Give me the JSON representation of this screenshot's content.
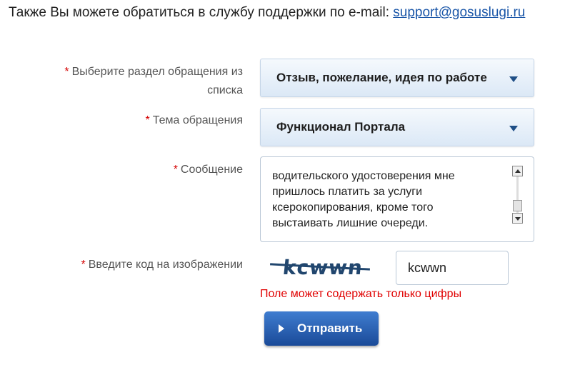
{
  "intro": {
    "text": "Также Вы можете обратиться в службу поддержки по e-mail: ",
    "email": "support@gosuslugi.ru"
  },
  "form": {
    "required_marker": "*",
    "section": {
      "label_line1": "Выберите раздел обращения из",
      "label_line2": "списка",
      "value": "Отзыв, пожелание, идея по работе"
    },
    "topic": {
      "label": "Тема обращения",
      "value": "Функционал Портала"
    },
    "message": {
      "label": "Сообщение",
      "value": "водительского удостоверения мне\nпришлось платить за услуги\nксерокопирования, кроме того\nвыстаивать лишние очереди."
    },
    "captcha": {
      "label": "Введите код на изображении",
      "image_text": "kcwwn",
      "input_value": "kcwwn",
      "error": "Поле может содержать только цифры"
    },
    "submit_label": "Отправить"
  },
  "icons": {
    "dropdown": "chevron-down-icon",
    "submit": "play-icon"
  },
  "colors": {
    "link": "#1a56a8",
    "error": "#e00000",
    "button": "#2a5fae"
  }
}
